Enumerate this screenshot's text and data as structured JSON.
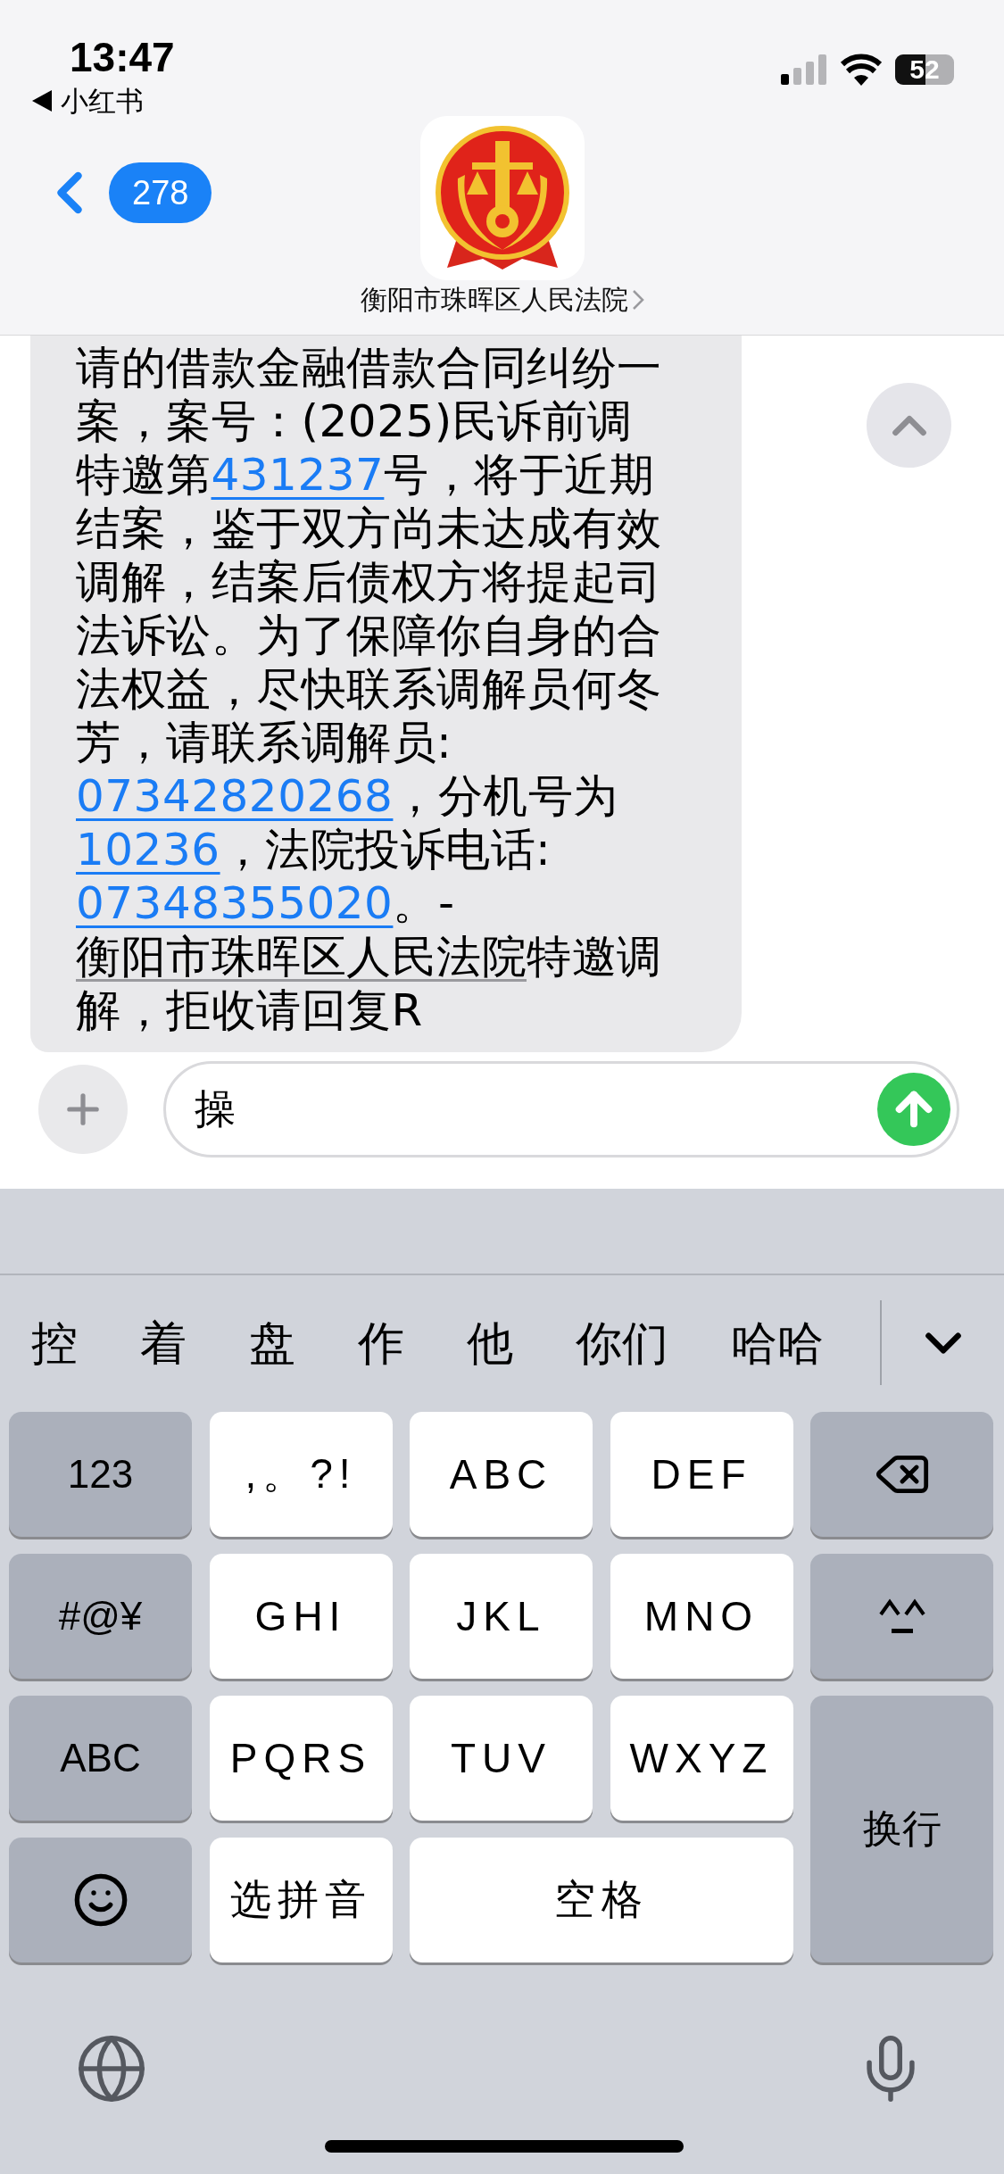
{
  "status_bar": {
    "time": "13:47",
    "back_app": "小红书",
    "battery": "52"
  },
  "header": {
    "unread_count": "278",
    "contact_name": "衡阳市珠晖区人民法院"
  },
  "message": {
    "segments": [
      {
        "kind": "text",
        "text": "请的借款金融借款合同纠纷一案，案号：(2025)民诉前调特邀第"
      },
      {
        "kind": "link",
        "text": "431237"
      },
      {
        "kind": "text",
        "text": "号，将于近期结案，鉴于双方尚未达成有效调解，结案后债权方将提起司法诉讼。为了保障你自身的合法权益，尽快联系调解员何冬芳，请联系调解员:"
      },
      {
        "kind": "link",
        "text": "07342820268"
      },
      {
        "kind": "text",
        "text": "，分机号为"
      },
      {
        "kind": "link",
        "text": "10236"
      },
      {
        "kind": "text",
        "text": "，法院投诉电话:"
      },
      {
        "kind": "link",
        "text": "07348355020"
      },
      {
        "kind": "text",
        "text": "。-"
      },
      {
        "kind": "detected",
        "text": "衡阳市珠晖区人民法院"
      },
      {
        "kind": "text",
        "text": "特邀调解，拒收请回复R"
      }
    ]
  },
  "composer": {
    "value": "操"
  },
  "keyboard": {
    "candidates": [
      "控",
      "着",
      "盘",
      "作",
      "他",
      "你们",
      "哈哈"
    ],
    "keys": [
      {
        "kind": "function",
        "label": "123"
      },
      {
        "kind": "char",
        "label": ",。?!"
      },
      {
        "kind": "char",
        "label": "ABC"
      },
      {
        "kind": "char",
        "label": "DEF"
      },
      {
        "kind": "delete"
      },
      {
        "kind": "function",
        "label": "#@¥"
      },
      {
        "kind": "char",
        "label": "GHI"
      },
      {
        "kind": "char",
        "label": "JKL"
      },
      {
        "kind": "char",
        "label": "MNO"
      },
      {
        "kind": "emoticon"
      },
      {
        "kind": "function",
        "label": "ABC"
      },
      {
        "kind": "char",
        "label": "PQRS"
      },
      {
        "kind": "char",
        "label": "TUV"
      },
      {
        "kind": "char",
        "label": "WXYZ"
      },
      {
        "kind": "return",
        "label": "换行"
      },
      {
        "kind": "emoji"
      },
      {
        "kind": "char",
        "label": "选拼音"
      },
      {
        "kind": "space",
        "label": "空格"
      }
    ]
  }
}
